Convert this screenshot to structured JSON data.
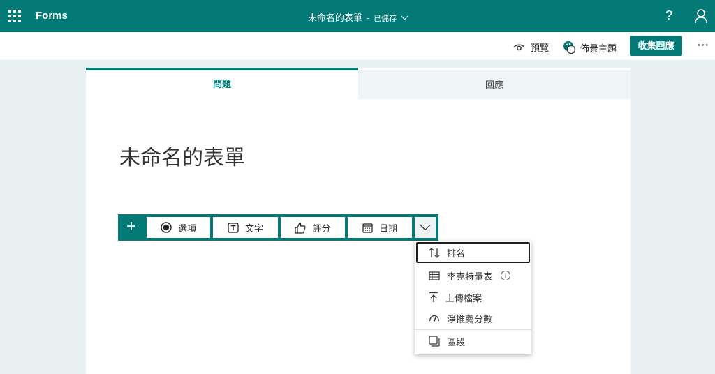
{
  "app": {
    "name": "Forms"
  },
  "document": {
    "title": "未命名的表單",
    "separator": "-",
    "save_status": "已儲存"
  },
  "header": {
    "help": "?"
  },
  "command_bar": {
    "preview_label": "預覽",
    "theme_label": "佈景主題",
    "collect_label": "收集回應",
    "more_label": "···"
  },
  "tabs": [
    {
      "label": "問題",
      "active": true
    },
    {
      "label": "回應",
      "active": false
    }
  ],
  "form": {
    "title": "未命名的表單"
  },
  "question_bar": {
    "add": "+",
    "buttons": [
      {
        "label": "選項",
        "icon": "radio-icon"
      },
      {
        "label": "文字",
        "icon": "text-icon"
      },
      {
        "label": "評分",
        "icon": "thumb-icon"
      },
      {
        "label": "日期",
        "icon": "calendar-icon"
      }
    ]
  },
  "dropdown": {
    "items": [
      {
        "label": "排名",
        "icon": "ranking-icon",
        "focused": true
      },
      {
        "label": "李克特量表",
        "icon": "likert-icon",
        "info": "i"
      },
      {
        "label": "上傳檔案",
        "icon": "upload-icon"
      },
      {
        "label": "淨推薦分數",
        "icon": "nps-icon"
      },
      {
        "label": "區段",
        "icon": "section-icon"
      }
    ]
  },
  "colors": {
    "brand": "#037a76",
    "background": "#e9f0f2"
  }
}
